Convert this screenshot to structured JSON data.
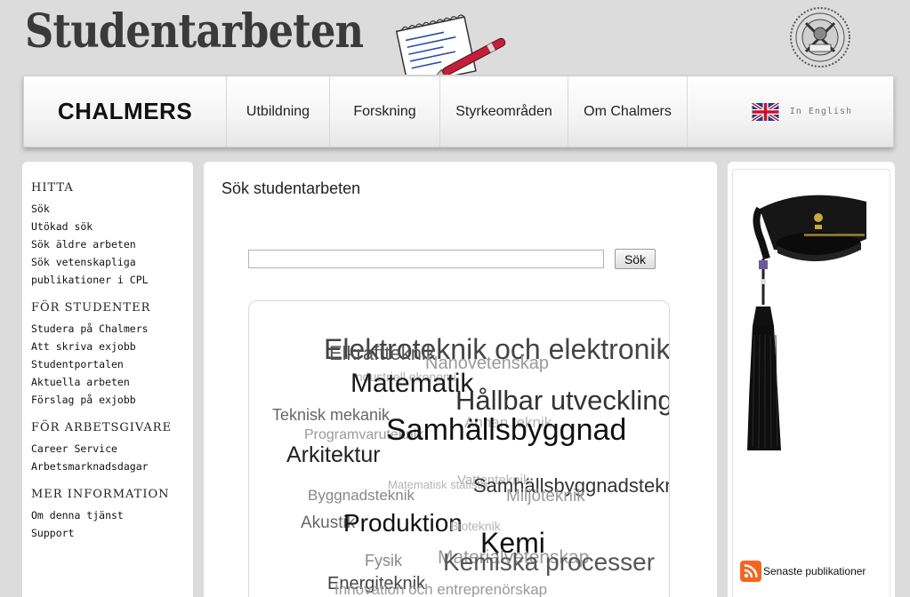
{
  "header": {
    "site_title": "Studentarbeten"
  },
  "nav": {
    "logo": "CHALMERS",
    "items": [
      "Utbildning",
      "Forskning",
      "Styrkeområden",
      "Om Chalmers"
    ],
    "english": "In English"
  },
  "sidebar": {
    "sections": [
      {
        "title": "HITTA",
        "links": [
          "Sök",
          "Utökad sök",
          "Sök äldre arbeten",
          "Sök vetenskapliga",
          "publikationer i CPL"
        ]
      },
      {
        "title": "FÖR STUDENTER",
        "links": [
          "Studera på Chalmers",
          "Att skriva exjobb",
          "Studentportalen",
          "Aktuella arbeten",
          "Förslag på exjobb"
        ]
      },
      {
        "title": "FÖR ARBETSGIVARE",
        "links": [
          "Career Service",
          "Arbetsmarknadsdagar"
        ]
      },
      {
        "title": "MER INFORMATION",
        "links": [
          "Om denna tjänst",
          "Support"
        ]
      }
    ]
  },
  "main": {
    "heading": "Sök studentarbeten",
    "search_value": "",
    "search_button": "Sök"
  },
  "tag_cloud": [
    "Elektroteknik och elektronik",
    "Elkraftteknik",
    "Nanovetenskap",
    "Industriell ekonomi",
    "Matematik",
    "Hållbar utveckling",
    "Teknisk mekanik",
    "Annan teknik",
    "Programvaruteknik",
    "Samhällsbyggnad",
    "Arkitektur",
    "Matematisk statistik",
    "Vattenteknik",
    "Samhällsbyggnadsteknik",
    "Byggnadsteknik",
    "Miljöteknik",
    "Akustik",
    "Produktion",
    "Bioteknik",
    "Kemi",
    "Fysik",
    "Materialvetenskap",
    "Kemiska processer",
    "Energiteknik",
    "Innovation och entreprenörskap"
  ],
  "right": {
    "rss_label": "Senaste publikationer"
  },
  "colors": {
    "background": "#dcdcdc",
    "tag_dark": "#1a1a1a",
    "tag_light": "#9a9a9a",
    "rss_orange": "#f26522"
  }
}
